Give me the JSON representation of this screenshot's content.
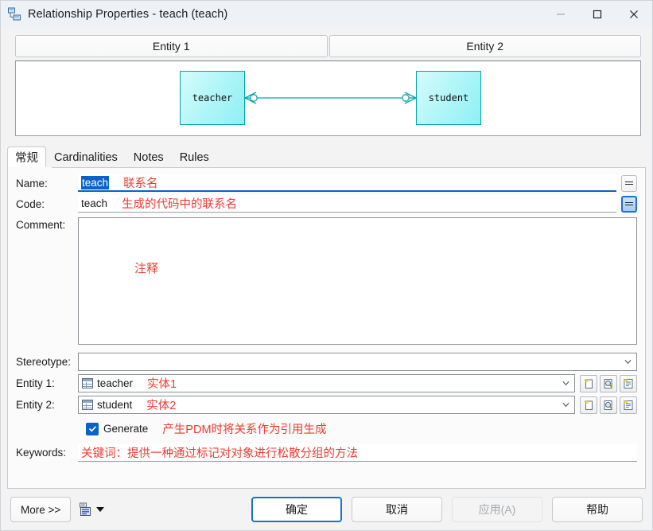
{
  "window": {
    "title": "Relationship Properties - teach (teach)",
    "icon": "relationship-icon",
    "controls": {
      "minimize": "—",
      "maximize": "□",
      "close": "✕"
    }
  },
  "entity_headers": [
    {
      "label": "Entity 1"
    },
    {
      "label": "Entity 2"
    }
  ],
  "diagram": {
    "entities": [
      {
        "name": "teacher"
      },
      {
        "name": "student"
      }
    ],
    "line_color": "#06a6a6",
    "fill_color": "#b4f6f8",
    "cardinality": "many-to-many-optional"
  },
  "tabs": [
    {
      "label": "常规",
      "active": true
    },
    {
      "label": "Cardinalities",
      "active": false
    },
    {
      "label": "Notes",
      "active": false
    },
    {
      "label": "Rules",
      "active": false
    }
  ],
  "form": {
    "name": {
      "label": "Name:",
      "value": "teach",
      "selected": true,
      "annotation": "联系名",
      "equals_button": "="
    },
    "code": {
      "label": "Code:",
      "value": "teach",
      "annotation": "生成的代码中的联系名",
      "equals_button": "="
    },
    "comment": {
      "label": "Comment:",
      "value": "",
      "annotation": "注释"
    },
    "stereotype": {
      "label": "Stereotype:",
      "value": ""
    },
    "entity1": {
      "label": "Entity 1:",
      "value": "teacher",
      "annotation": "实体1",
      "icon": "table-icon"
    },
    "entity2": {
      "label": "Entity 2:",
      "value": "student",
      "annotation": "实体2",
      "icon": "table-icon"
    },
    "generate": {
      "label": "Generate",
      "checked": true,
      "annotation": "产生PDM时将关系作为引用生成"
    },
    "keywords": {
      "label": "Keywords:",
      "value": "",
      "annotation": "关键词：提供一种通过标记对对象进行松散分组的方法"
    }
  },
  "row_buttons": [
    {
      "name": "create-icon"
    },
    {
      "name": "find-icon"
    },
    {
      "name": "properties-icon"
    }
  ],
  "footer": {
    "more": "More >>",
    "ok": "确定",
    "cancel": "取消",
    "apply": "应用(A)",
    "help": "帮助"
  },
  "colors": {
    "accent": "#0a62c8",
    "annotation": "#f03a33",
    "entity_border": "#06a6a6",
    "title_bg": "#eef2f7"
  }
}
